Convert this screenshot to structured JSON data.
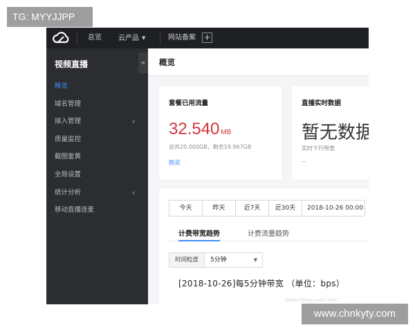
{
  "watermarks": {
    "top_left": "TG: MYYJJPP",
    "bottom_right": "www.chnkyty.com",
    "faint": "https://blog.csdn.net/..."
  },
  "topbar": {
    "logo_icon": "cloud-logo-icon",
    "overview": "总览",
    "products": "云产品",
    "icp": "网站备案",
    "add_icon": "+"
  },
  "sidebar": {
    "title": "视频直播",
    "collapse_icon": "«",
    "items": [
      {
        "label": "概览",
        "active": true,
        "chevron": ""
      },
      {
        "label": "域名管理",
        "active": false,
        "chevron": ""
      },
      {
        "label": "接入管理",
        "active": false,
        "chevron": "∨"
      },
      {
        "label": "质量监控",
        "active": false,
        "chevron": ""
      },
      {
        "label": "截图鉴黄",
        "active": false,
        "chevron": ""
      },
      {
        "label": "全局设置",
        "active": false,
        "chevron": ""
      },
      {
        "label": "统计分析",
        "active": false,
        "chevron": "∨"
      },
      {
        "label": "移动直播连麦",
        "active": false,
        "chevron": ""
      }
    ]
  },
  "main": {
    "page_title": "概览",
    "package_card": {
      "title": "套餐已用流量",
      "value": "32.540",
      "unit": "MB",
      "detail": "总共20.000GB，剩余19.967GB",
      "buy": "购买"
    },
    "live_card": {
      "title": "直播实时数据",
      "nodata": "暂无数据",
      "sub": "实时下行带宽",
      "dash": "--"
    },
    "date_buttons": [
      "今天",
      "昨天",
      "近7天",
      "近30天"
    ],
    "date_range": "2018-10-26 00:00",
    "tabs": [
      "计费带宽趋势",
      "计费流量趋势"
    ],
    "granularity_label": "时间粒度",
    "granularity_value": "5分钟",
    "chart_title": "[2018-10-26]每5分钟带宽 （单位：bps）"
  },
  "colors": {
    "topbar": "#1f2023",
    "sidebar": "#2b2d31",
    "accent": "#3d8bfd",
    "value_red": "#d0363b"
  }
}
